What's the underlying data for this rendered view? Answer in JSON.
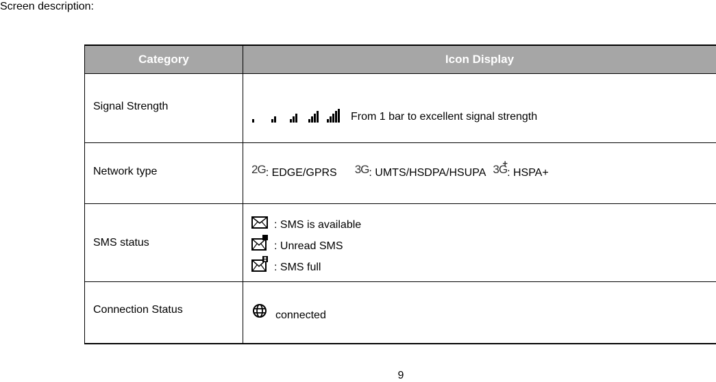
{
  "heading": "Screen description:",
  "table": {
    "headers": {
      "category": "Category",
      "icon_display": "Icon Display"
    },
    "rows": {
      "signal": {
        "category": "Signal Strength",
        "icons": [
          "signal-1-bar-icon",
          "signal-2-bars-icon",
          "signal-3-bars-icon",
          "signal-4-bars-icon",
          "signal-5-bars-icon"
        ],
        "description": "From 1 bar to excellent signal strength"
      },
      "network": {
        "category": "Network type",
        "items": [
          {
            "icon_label": "2G",
            "icon": "2g-icon",
            "description": ": EDGE/GPRS"
          },
          {
            "icon_label": "3G",
            "icon": "3g-icon",
            "description": ": UMTS/HSDPA/HSUPA"
          },
          {
            "icon_label": "3G",
            "icon_extra": "+",
            "icon": "3g-plus-icon",
            "description": ": HSPA+"
          }
        ]
      },
      "sms": {
        "category": "SMS status",
        "items": [
          {
            "icon": "sms-envelope-icon",
            "description": ": SMS is available"
          },
          {
            "icon": "sms-unread-icon",
            "description": ": Unread SMS"
          },
          {
            "icon": "sms-full-icon",
            "description": ": SMS full"
          }
        ]
      },
      "connection": {
        "category": "Connection Status",
        "icon": "globe-icon",
        "description": "connected"
      }
    }
  },
  "page_number": "9"
}
